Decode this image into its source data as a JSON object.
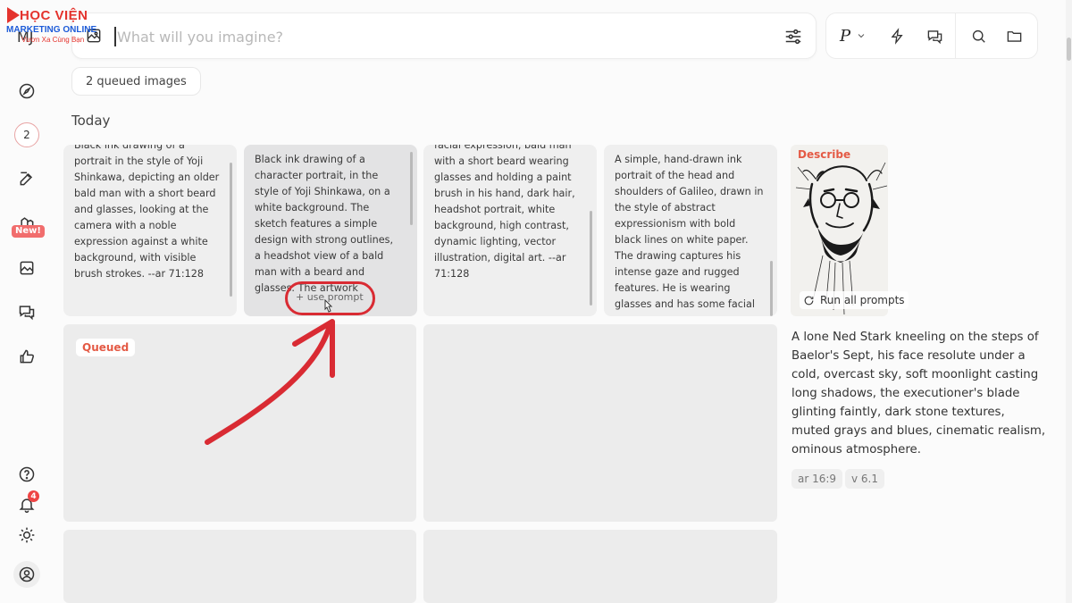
{
  "watermark": {
    "line1": "HỌC VIỆN",
    "line2": "MARKETING ONLINE",
    "line3": "Vươn Xa Cùng Bạn"
  },
  "app": {
    "logo_text": "MJ"
  },
  "search": {
    "placeholder": "What will you imagine?"
  },
  "toolbar": {
    "personalize_label": "P"
  },
  "queue": {
    "label": "2 queued images"
  },
  "section": {
    "title": "Today"
  },
  "prompt_cards": [
    {
      "lines_top": "Black ink drawing of a",
      "text": "portrait in the style of Yoji Shinkawa, depicting an older bald man with a short beard and glasses, looking at the camera with a noble expression against a white background, with visible brush strokes. --ar 71:128"
    },
    {
      "text": "Black ink drawing of a character portrait, in the style of Yoji Shinkawa, on a white background. The sketch features a simple design with strong outlines,",
      "faded_text": "a headshot view of a bald man with a beard and glasses. The artwork",
      "hover_action": "+ use prompt"
    },
    {
      "lines_top": "facial expression, bald man",
      "text": "with a short beard wearing glasses and holding a paint brush in his hand, dark hair, headshot portrait, white background, high contrast, dynamic lighting, vector illustration, digital art. --ar 71:128"
    },
    {
      "text": "A simple, hand-drawn ink portrait of the head and shoulders of Galileo, drawn in the style of abstract expressionism with bold black lines on white paper. The drawing captures his intense gaze and rugged features. He is wearing glasses and has some facial"
    }
  ],
  "queued": {
    "tag": "Queued"
  },
  "describe_panel": {
    "label": "Describe",
    "run_all": "Run all prompts",
    "prompt": "A lone Ned Stark kneeling on the steps of Baelor's Sept, his face resolute under a cold, overcast sky, soft moonlight casting long shadows, the executioner's blade glinting faintly, dark stone textures, muted grays and blues, cinematic realism, ominous atmosphere.",
    "params": [
      "ar 16:9",
      "v 6.1"
    ]
  },
  "sidebar": {
    "count": "2",
    "new_badge": "New!",
    "notification_count": "4"
  },
  "colors": {
    "accent_red": "#d92b33",
    "describe_orange": "#e45a45",
    "card_bg": "#efefef"
  }
}
